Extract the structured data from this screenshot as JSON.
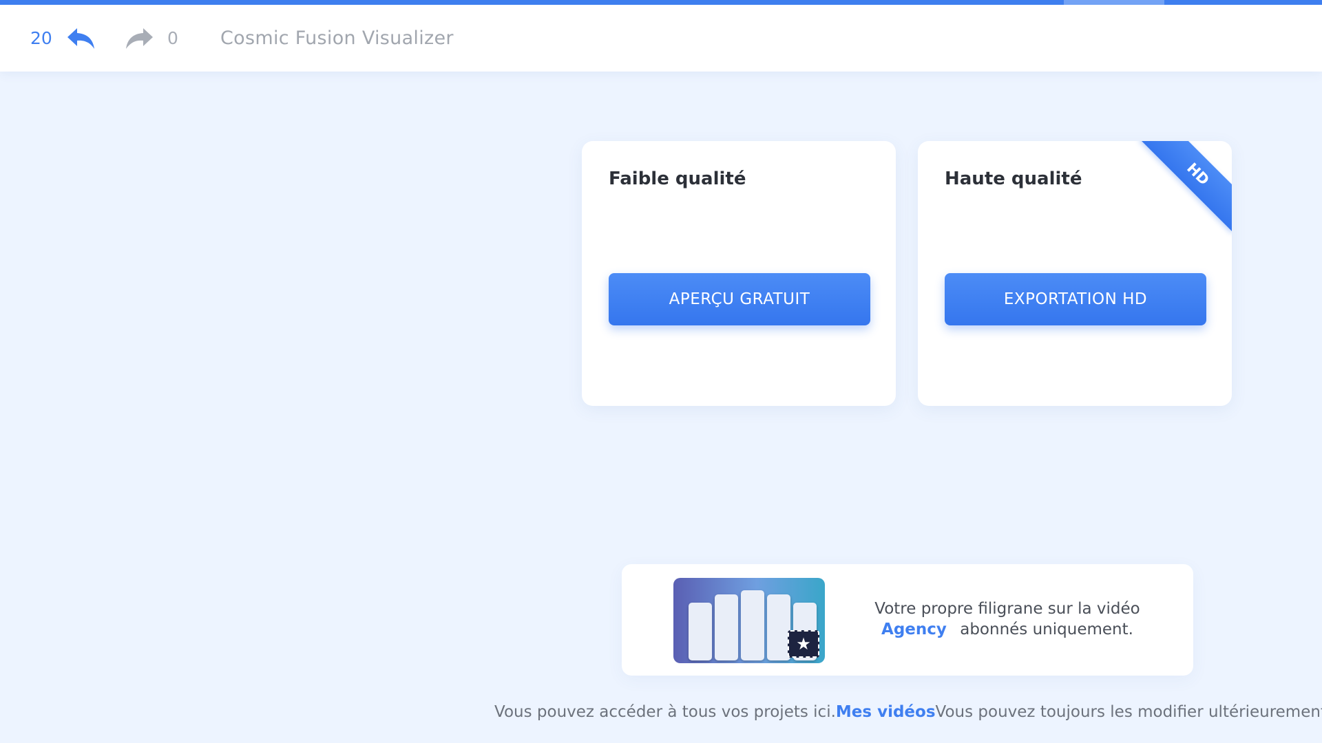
{
  "header": {
    "undo_count": "20",
    "redo_count": "0",
    "project_title": "Cosmic Fusion Visualizer"
  },
  "cards": {
    "low": {
      "title": "Faible qualité",
      "button_label": "APERÇU GRATUIT"
    },
    "high": {
      "title": "Haute qualité",
      "button_label": "EXPORTATION HD",
      "ribbon": "HD"
    }
  },
  "promo": {
    "line1": "Votre propre filigrane sur la vidéo",
    "agency": "Agency",
    "line2_rest": "abonnés uniquement."
  },
  "footer": {
    "before": "Vous pouvez accéder à tous vos projets ici.",
    "link": "Mes vidéos",
    "after": "Vous pouvez toujours les modifier ultérieurement."
  },
  "colors": {
    "accent": "#3f7ff0",
    "background": "#edf4ff"
  }
}
